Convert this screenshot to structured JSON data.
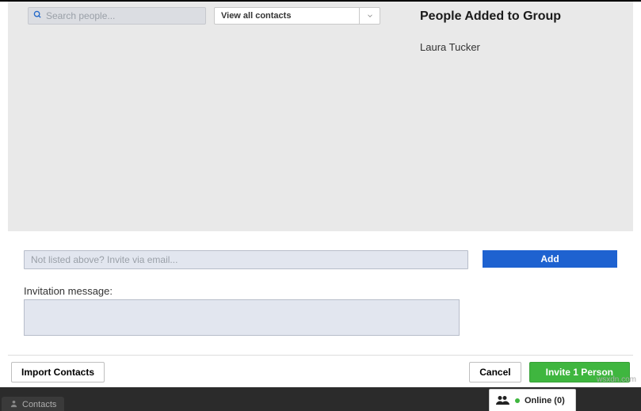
{
  "search": {
    "placeholder": "Search people..."
  },
  "filter": {
    "selected": "View all contacts"
  },
  "right": {
    "title": "People Added to Group",
    "members": [
      "Laura Tucker"
    ]
  },
  "emailInvite": {
    "placeholder": "Not listed above? Invite via email..."
  },
  "addButton": "Add",
  "invitationLabel": "Invitation message:",
  "bottom": {
    "import": "Import Contacts",
    "cancel": "Cancel",
    "invite": "Invite 1 Person"
  },
  "statusBar": {
    "contactsTab": "Contacts",
    "onlineLabel": "Online",
    "onlineCount": 0
  },
  "watermark": "wsxdn.com"
}
